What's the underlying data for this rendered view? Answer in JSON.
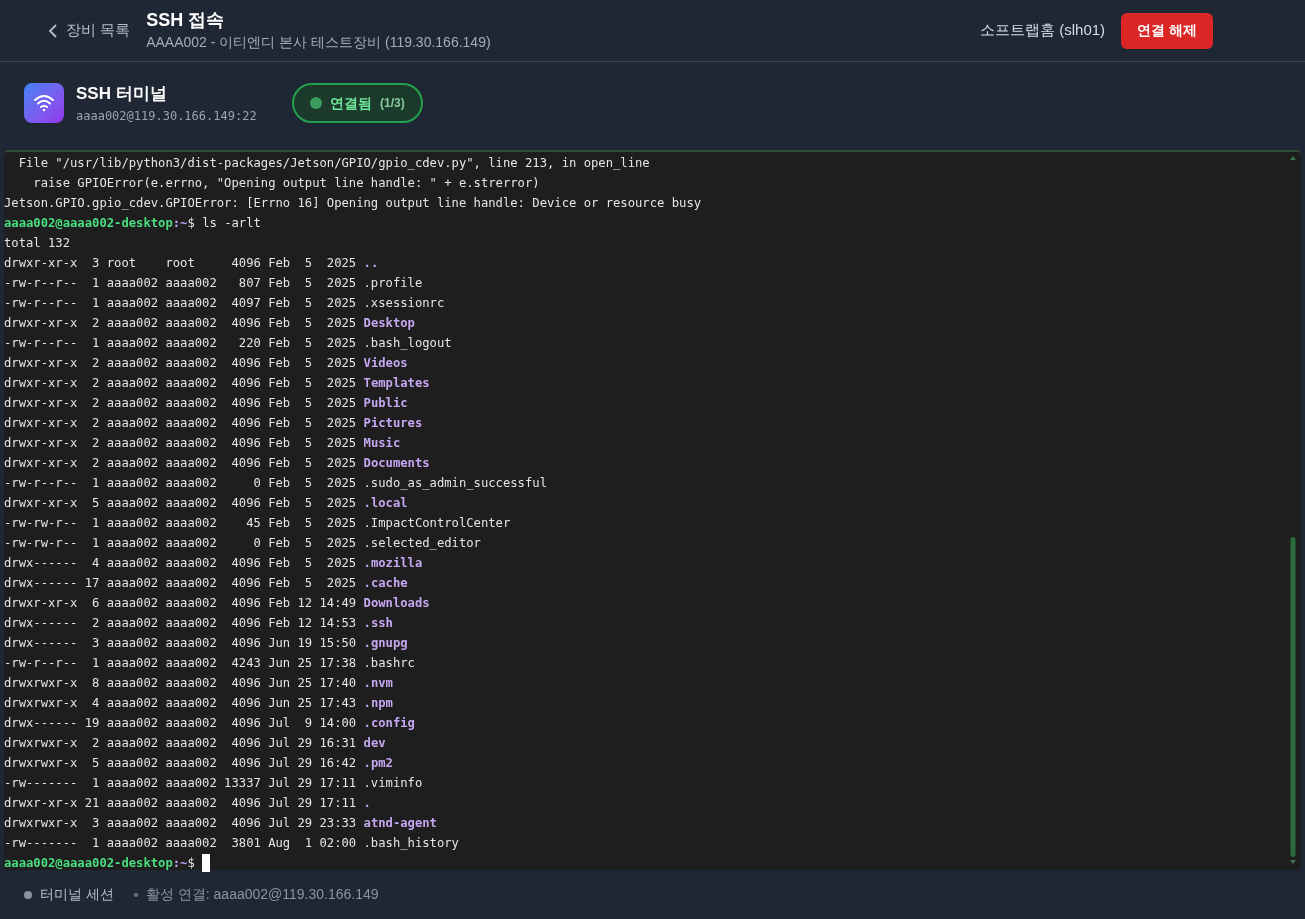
{
  "header": {
    "back_label": "장비 목록",
    "title": "SSH 접속",
    "subtitle": "AAAA002 - 이티엔디 본사 테스트장비 (119.30.166.149)",
    "user": "소프트랩홈 (slh01)",
    "disconnect_button": "연결 해제"
  },
  "session": {
    "title": "SSH 터미널",
    "address": "aaaa002@119.30.166.149:22",
    "status": {
      "label": "연결됨",
      "count": "(1/3)",
      "connected": true
    }
  },
  "terminal": {
    "cursor": true,
    "lines": [
      {
        "segments": [
          {
            "text": "  File \"/usr/lib/python3/dist-packages/Jetson/GPIO/gpio_cdev.py\", line 213, in open_line",
            "kind": "plain"
          }
        ]
      },
      {
        "segments": [
          {
            "text": "    raise GPIOError(e.errno, \"Opening output line handle: \" + e.strerror)",
            "kind": "plain"
          }
        ]
      },
      {
        "segments": [
          {
            "text": "Jetson.GPIO.gpio_cdev.GPIOError: [Errno 16] Opening output line handle: Device or resource busy",
            "kind": "plain"
          }
        ]
      },
      {
        "segments": [
          {
            "text": "aaaa002@aaaa002-desktop",
            "kind": "user"
          },
          {
            "text": ":~",
            "kind": "path"
          },
          {
            "text": "$ ls -arlt",
            "kind": "plain"
          }
        ]
      },
      {
        "segments": [
          {
            "text": "total 132",
            "kind": "plain"
          }
        ]
      },
      {
        "segments": [
          {
            "text": "drwxr-xr-x  3 root    root     4096 Feb  5  2025 ",
            "kind": "plain"
          },
          {
            "text": "..",
            "kind": "dir"
          }
        ]
      },
      {
        "segments": [
          {
            "text": "-rw-r--r--  1 aaaa002 aaaa002   807 Feb  5  2025 .profile",
            "kind": "plain"
          }
        ]
      },
      {
        "segments": [
          {
            "text": "-rw-r--r--  1 aaaa002 aaaa002  4097 Feb  5  2025 .xsessionrc",
            "kind": "plain"
          }
        ]
      },
      {
        "segments": [
          {
            "text": "drwxr-xr-x  2 aaaa002 aaaa002  4096 Feb  5  2025 ",
            "kind": "plain"
          },
          {
            "text": "Desktop",
            "kind": "dir"
          }
        ]
      },
      {
        "segments": [
          {
            "text": "-rw-r--r--  1 aaaa002 aaaa002   220 Feb  5  2025 .bash_logout",
            "kind": "plain"
          }
        ]
      },
      {
        "segments": [
          {
            "text": "drwxr-xr-x  2 aaaa002 aaaa002  4096 Feb  5  2025 ",
            "kind": "plain"
          },
          {
            "text": "Videos",
            "kind": "dir"
          }
        ]
      },
      {
        "segments": [
          {
            "text": "drwxr-xr-x  2 aaaa002 aaaa002  4096 Feb  5  2025 ",
            "kind": "plain"
          },
          {
            "text": "Templates",
            "kind": "dir"
          }
        ]
      },
      {
        "segments": [
          {
            "text": "drwxr-xr-x  2 aaaa002 aaaa002  4096 Feb  5  2025 ",
            "kind": "plain"
          },
          {
            "text": "Public",
            "kind": "dir"
          }
        ]
      },
      {
        "segments": [
          {
            "text": "drwxr-xr-x  2 aaaa002 aaaa002  4096 Feb  5  2025 ",
            "kind": "plain"
          },
          {
            "text": "Pictures",
            "kind": "dir"
          }
        ]
      },
      {
        "segments": [
          {
            "text": "drwxr-xr-x  2 aaaa002 aaaa002  4096 Feb  5  2025 ",
            "kind": "plain"
          },
          {
            "text": "Music",
            "kind": "dir"
          }
        ]
      },
      {
        "segments": [
          {
            "text": "drwxr-xr-x  2 aaaa002 aaaa002  4096 Feb  5  2025 ",
            "kind": "plain"
          },
          {
            "text": "Documents",
            "kind": "dir"
          }
        ]
      },
      {
        "segments": [
          {
            "text": "-rw-r--r--  1 aaaa002 aaaa002     0 Feb  5  2025 .sudo_as_admin_successful",
            "kind": "plain"
          }
        ]
      },
      {
        "segments": [
          {
            "text": "drwxr-xr-x  5 aaaa002 aaaa002  4096 Feb  5  2025 ",
            "kind": "plain"
          },
          {
            "text": ".local",
            "kind": "dir"
          }
        ]
      },
      {
        "segments": [
          {
            "text": "-rw-rw-r--  1 aaaa002 aaaa002    45 Feb  5  2025 .ImpactControlCenter",
            "kind": "plain"
          }
        ]
      },
      {
        "segments": [
          {
            "text": "-rw-rw-r--  1 aaaa002 aaaa002     0 Feb  5  2025 .selected_editor",
            "kind": "plain"
          }
        ]
      },
      {
        "segments": [
          {
            "text": "drwx------  4 aaaa002 aaaa002  4096 Feb  5  2025 ",
            "kind": "plain"
          },
          {
            "text": ".mozilla",
            "kind": "dir"
          }
        ]
      },
      {
        "segments": [
          {
            "text": "drwx------ 17 aaaa002 aaaa002  4096 Feb  5  2025 ",
            "kind": "plain"
          },
          {
            "text": ".cache",
            "kind": "dir"
          }
        ]
      },
      {
        "segments": [
          {
            "text": "drwxr-xr-x  6 aaaa002 aaaa002  4096 Feb 12 14:49 ",
            "kind": "plain"
          },
          {
            "text": "Downloads",
            "kind": "dir"
          }
        ]
      },
      {
        "segments": [
          {
            "text": "drwx------  2 aaaa002 aaaa002  4096 Feb 12 14:53 ",
            "kind": "plain"
          },
          {
            "text": ".ssh",
            "kind": "dir"
          }
        ]
      },
      {
        "segments": [
          {
            "text": "drwx------  3 aaaa002 aaaa002  4096 Jun 19 15:50 ",
            "kind": "plain"
          },
          {
            "text": ".gnupg",
            "kind": "dir"
          }
        ]
      },
      {
        "segments": [
          {
            "text": "-rw-r--r--  1 aaaa002 aaaa002  4243 Jun 25 17:38 .bashrc",
            "kind": "plain"
          }
        ]
      },
      {
        "segments": [
          {
            "text": "drwxrwxr-x  8 aaaa002 aaaa002  4096 Jun 25 17:40 ",
            "kind": "plain"
          },
          {
            "text": ".nvm",
            "kind": "dir"
          }
        ]
      },
      {
        "segments": [
          {
            "text": "drwxrwxr-x  4 aaaa002 aaaa002  4096 Jun 25 17:43 ",
            "kind": "plain"
          },
          {
            "text": ".npm",
            "kind": "dir"
          }
        ]
      },
      {
        "segments": [
          {
            "text": "drwx------ 19 aaaa002 aaaa002  4096 Jul  9 14:00 ",
            "kind": "plain"
          },
          {
            "text": ".config",
            "kind": "dir"
          }
        ]
      },
      {
        "segments": [
          {
            "text": "drwxrwxr-x  2 aaaa002 aaaa002  4096 Jul 29 16:31 ",
            "kind": "plain"
          },
          {
            "text": "dev",
            "kind": "dir"
          }
        ]
      },
      {
        "segments": [
          {
            "text": "drwxrwxr-x  5 aaaa002 aaaa002  4096 Jul 29 16:42 ",
            "kind": "plain"
          },
          {
            "text": ".pm2",
            "kind": "dir"
          }
        ]
      },
      {
        "segments": [
          {
            "text": "-rw-------  1 aaaa002 aaaa002 13337 Jul 29 17:11 .viminfo",
            "kind": "plain"
          }
        ]
      },
      {
        "segments": [
          {
            "text": "drwxr-xr-x 21 aaaa002 aaaa002  4096 Jul 29 17:11 ",
            "kind": "plain"
          },
          {
            "text": ".",
            "kind": "dir"
          }
        ]
      },
      {
        "segments": [
          {
            "text": "drwxrwxr-x  3 aaaa002 aaaa002  4096 Jul 29 23:33 ",
            "kind": "plain"
          },
          {
            "text": "atnd-agent",
            "kind": "dir"
          }
        ]
      },
      {
        "segments": [
          {
            "text": "-rw-------  1 aaaa002 aaaa002  3801 Aug  1 02:00 .bash_history",
            "kind": "plain"
          }
        ]
      },
      {
        "segments": [
          {
            "text": "aaaa002@aaaa002-desktop",
            "kind": "user"
          },
          {
            "text": ":~",
            "kind": "path"
          },
          {
            "text": "$ ",
            "kind": "plain"
          }
        ]
      }
    ]
  },
  "footer": {
    "session_label": "터미널 세션",
    "active_connection": "활성 연결: aaaa002@119.30.166.149"
  }
}
